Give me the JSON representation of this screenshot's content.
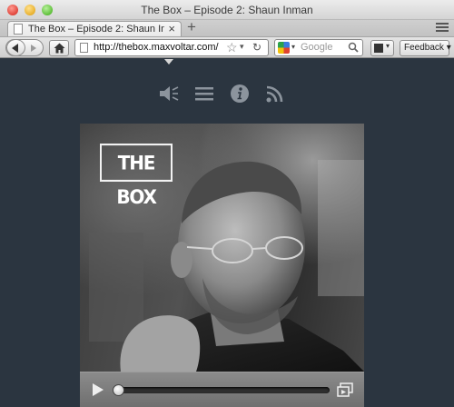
{
  "window": {
    "title": "The Box – Episode 2: Shaun Inman"
  },
  "tabs": {
    "active_label": "The Box – Episode 2: Shaun Inman",
    "close_glyph": "×",
    "new_tab_glyph": "+"
  },
  "navbar": {
    "url": "http://thebox.maxvoltar.com/",
    "bookmark_glyph": "☆",
    "url_dropdown_glyph": "▾",
    "reload_glyph": "↻",
    "search_placeholder": "Google",
    "search_engine_dropdown_glyph": "▾",
    "feedback_label": "Feedback ▾"
  },
  "page": {
    "toolbar_icons": [
      "speaker-icon",
      "menu-icon",
      "info-icon",
      "rss-icon"
    ],
    "logo_text": "THE BOX",
    "player": {
      "progress_fraction": 0.02
    },
    "colors": {
      "background": "#2b3540",
      "icon": "#8c949d",
      "controls_bar": "#7e7e7e"
    }
  }
}
